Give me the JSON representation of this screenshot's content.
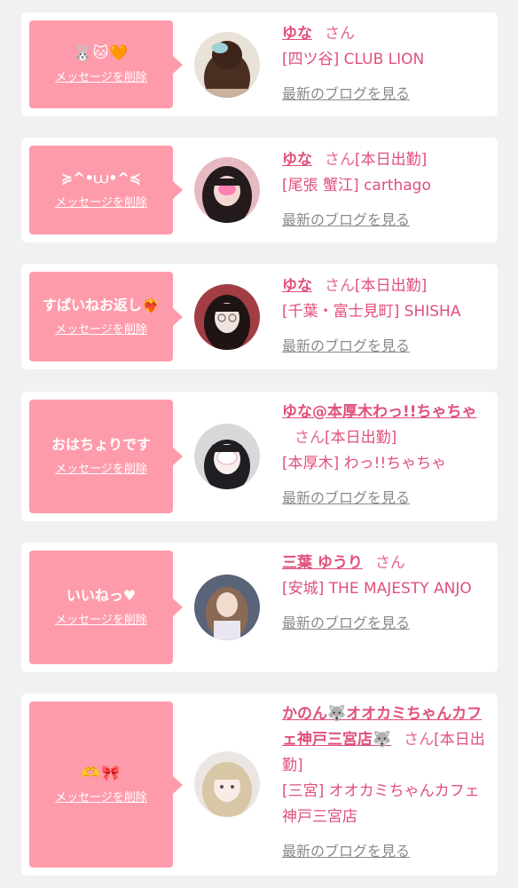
{
  "messages": [
    {
      "message": "🐰🐱🧡",
      "delete_label": "メッセージを削除",
      "name": "ゆな",
      "honorific": "さん",
      "status": "",
      "shop": "[四ツ谷] CLUB LION",
      "blog_label": "最新のブログを見る"
    },
    {
      "message": "≽^•⩊•^≼",
      "delete_label": "メッセージを削除",
      "name": "ゆな",
      "honorific": "さん",
      "status": "[本日出勤]",
      "shop": "[尾張 蟹江] carthago",
      "blog_label": "最新のブログを見る"
    },
    {
      "message": "すぱいねお返し❤️‍🔥",
      "delete_label": "メッセージを削除",
      "name": "ゆな",
      "honorific": "さん",
      "status": "[本日出勤]",
      "shop": "[千葉・富士見町] SHISHA",
      "blog_label": "最新のブログを見る"
    },
    {
      "message": "おはちょりです",
      "delete_label": "メッセージを削除",
      "name": "ゆな@本厚木わっ!!ちゃちゃ",
      "honorific": "さん",
      "status": "[本日出勤]",
      "shop": "[本厚木] わっ!!ちゃちゃ",
      "blog_label": "最新のブログを見る"
    },
    {
      "message": "いいねっ♥",
      "delete_label": "メッセージを削除",
      "name": "三葉 ゆうり",
      "honorific": "さん",
      "status": "",
      "shop": "[安城] THE MAJESTY ANJO",
      "blog_label": "最新のブログを見る"
    },
    {
      "message": "🫶🎀",
      "delete_label": "メッセージを削除",
      "name": "かのん🐺オオカミちゃんカフェ神戸三宮店🐺",
      "honorific": "さん",
      "status": "[本日出勤]",
      "shop": "[三宮] オオカミちゃんカフェ神戸三宮店",
      "blog_label": "最新のブログを見る"
    }
  ],
  "colors": {
    "background": "#f1f1f1",
    "card": "#ffffff",
    "bubble": "#fe9bab",
    "name": "#e0507a",
    "blog_link": "#8a8a8a"
  }
}
